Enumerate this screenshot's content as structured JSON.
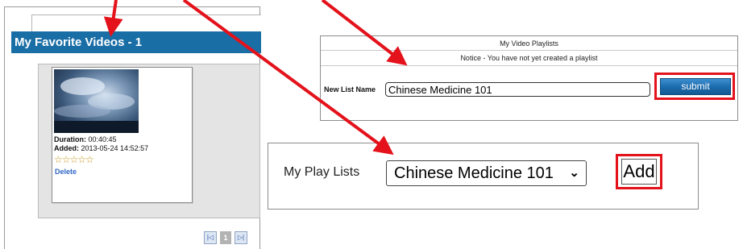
{
  "favorites": {
    "title": "My Favorite Videos - 1",
    "video": {
      "duration_label": "Duration:",
      "duration": "00:40:45",
      "added_label": "Added:",
      "added": "2013-05-24 14:52:57",
      "rating_stars": "☆☆☆☆☆",
      "delete_label": "Delete"
    },
    "pager": {
      "first_icon": "first-page-icon",
      "current_page": "1",
      "last_icon": "last-page-icon"
    }
  },
  "playlists_form": {
    "title": "My Video Playlists",
    "notice": "Notice - You have not yet created a playlist",
    "new_list_label": "New List Name",
    "new_list_value": "Chinese Medicine 101",
    "submit_label": "submit"
  },
  "play_lists": {
    "label": "My Play Lists",
    "selected": "Chinese Medicine 101",
    "add_label": "Add"
  },
  "colors": {
    "header_blue": "#1a6ea6",
    "annotation_red": "#e3121b",
    "link_blue": "#2f66c6"
  }
}
